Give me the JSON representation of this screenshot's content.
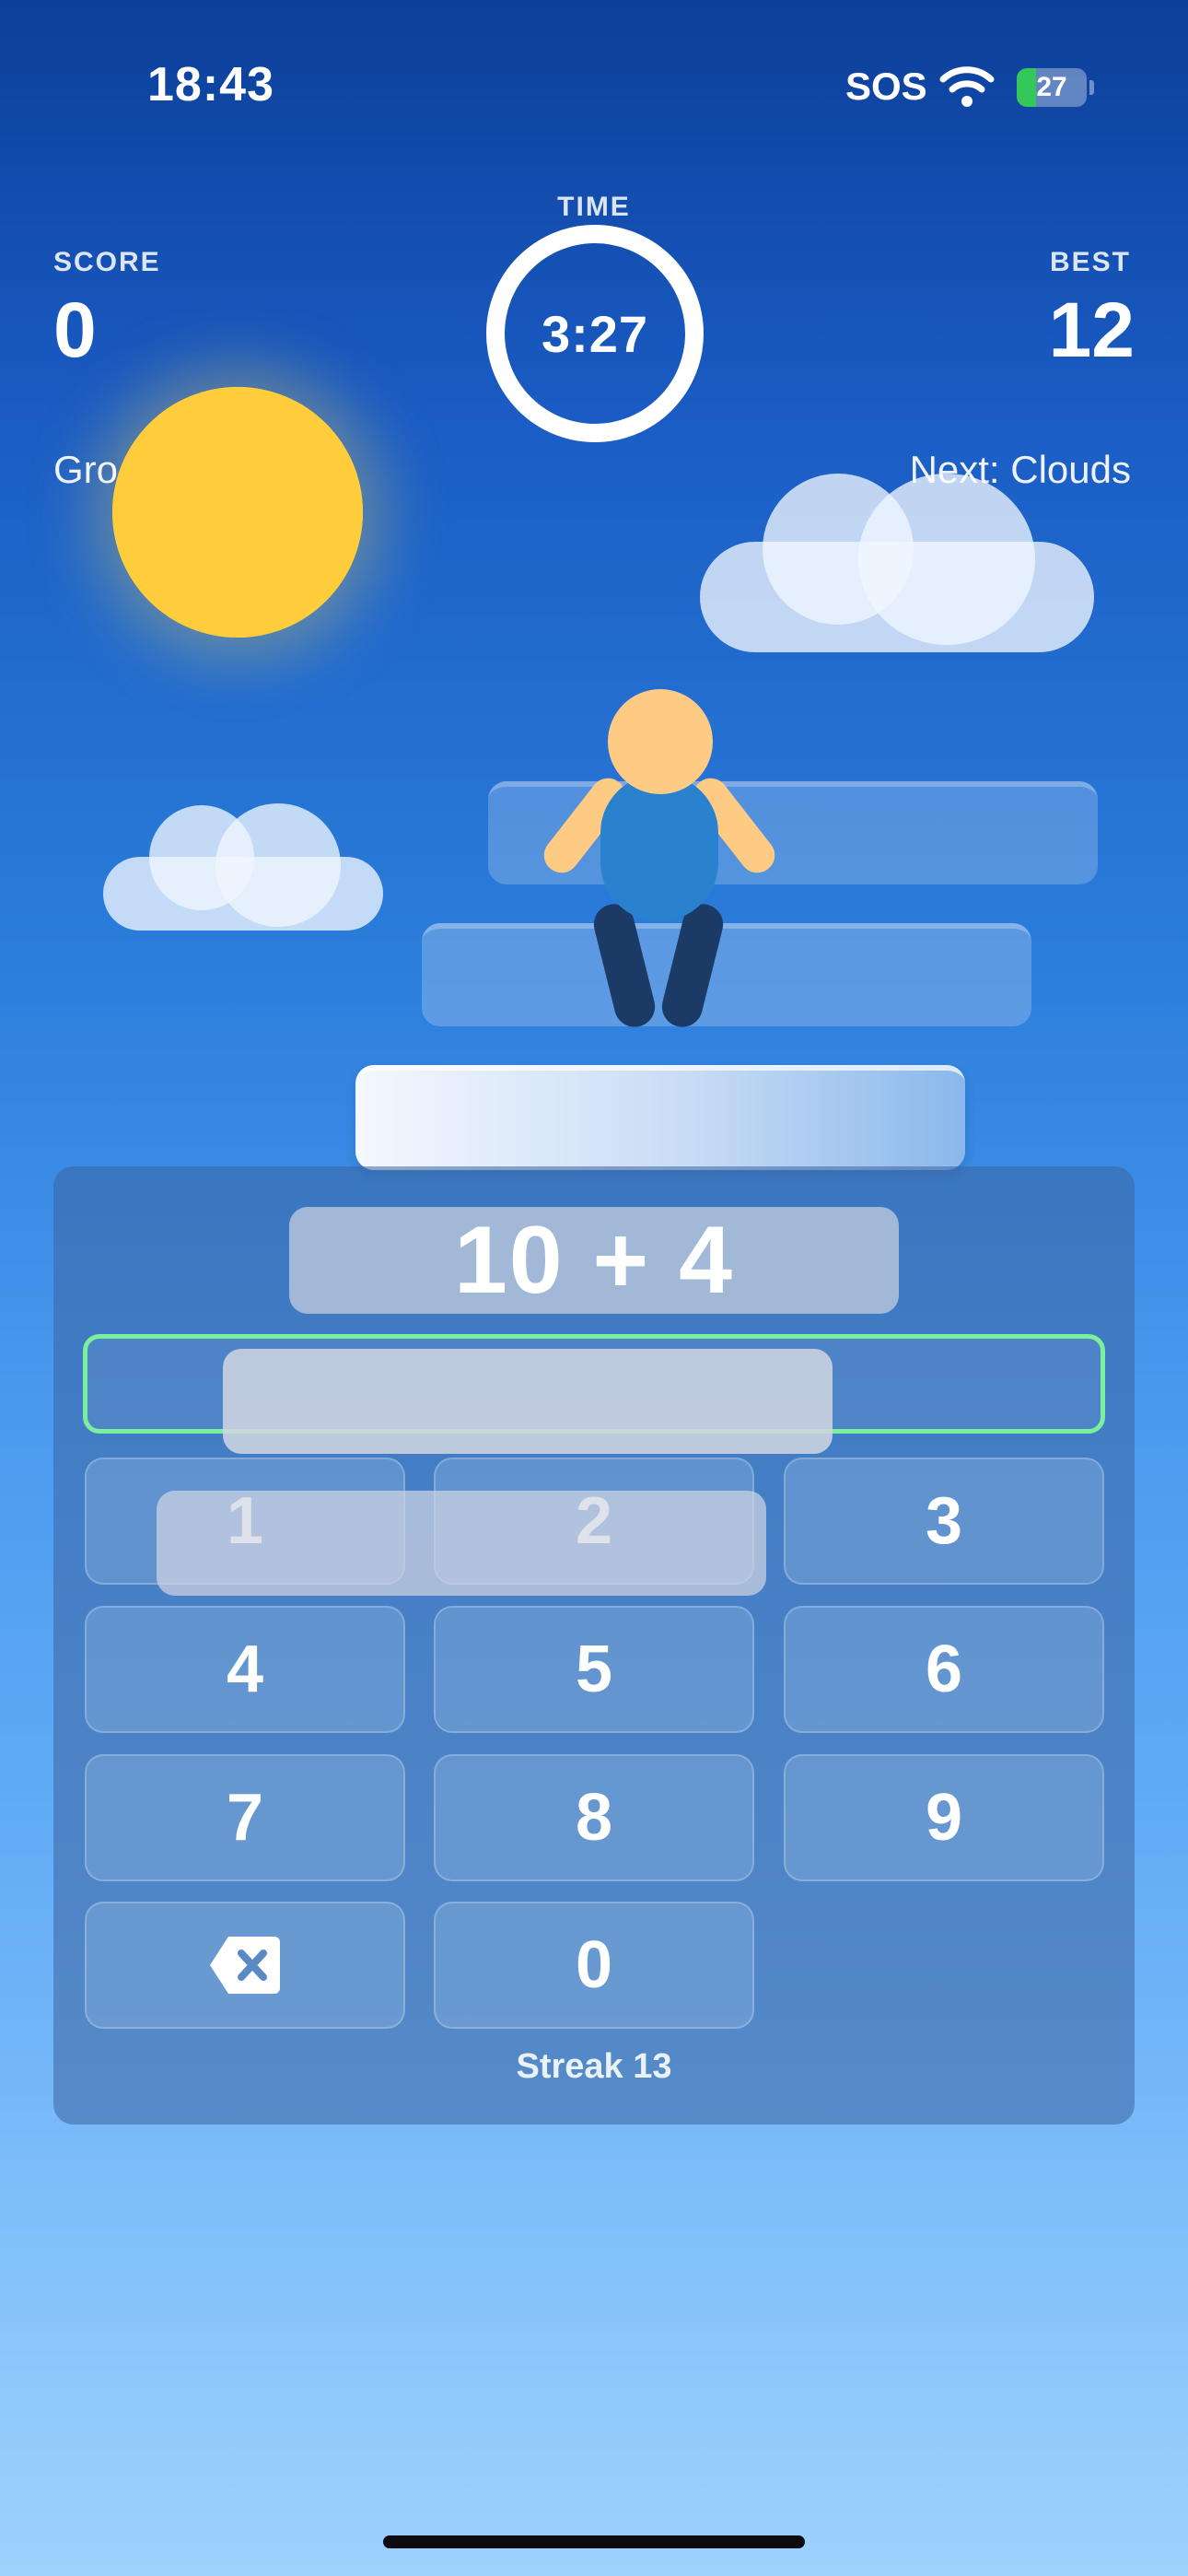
{
  "status_bar": {
    "time": "18:43",
    "sos": "SOS",
    "battery": "27",
    "battery_level": 0.27
  },
  "hud": {
    "score_label": "SCORE",
    "score": "0",
    "time_label": "TIME",
    "timer": "3:27",
    "best_label": "BEST",
    "best": "12"
  },
  "zone": {
    "current_partial": "Gro",
    "next": "Next: Clouds"
  },
  "question": {
    "text": "10 + 4",
    "answer_value": ""
  },
  "keypad": {
    "keys": [
      "1",
      "2",
      "3",
      "4",
      "5",
      "6",
      "7",
      "8",
      "9",
      "0"
    ],
    "backspace_icon": "backspace-icon"
  },
  "streak": "Streak 13",
  "colors": {
    "sun": "#ffcd3c",
    "answer_border": "#7af09a",
    "battery_green": "#34c759",
    "character_body": "#2a82cf",
    "character_skin": "#fdcb84",
    "character_legs": "#1b3b66"
  }
}
